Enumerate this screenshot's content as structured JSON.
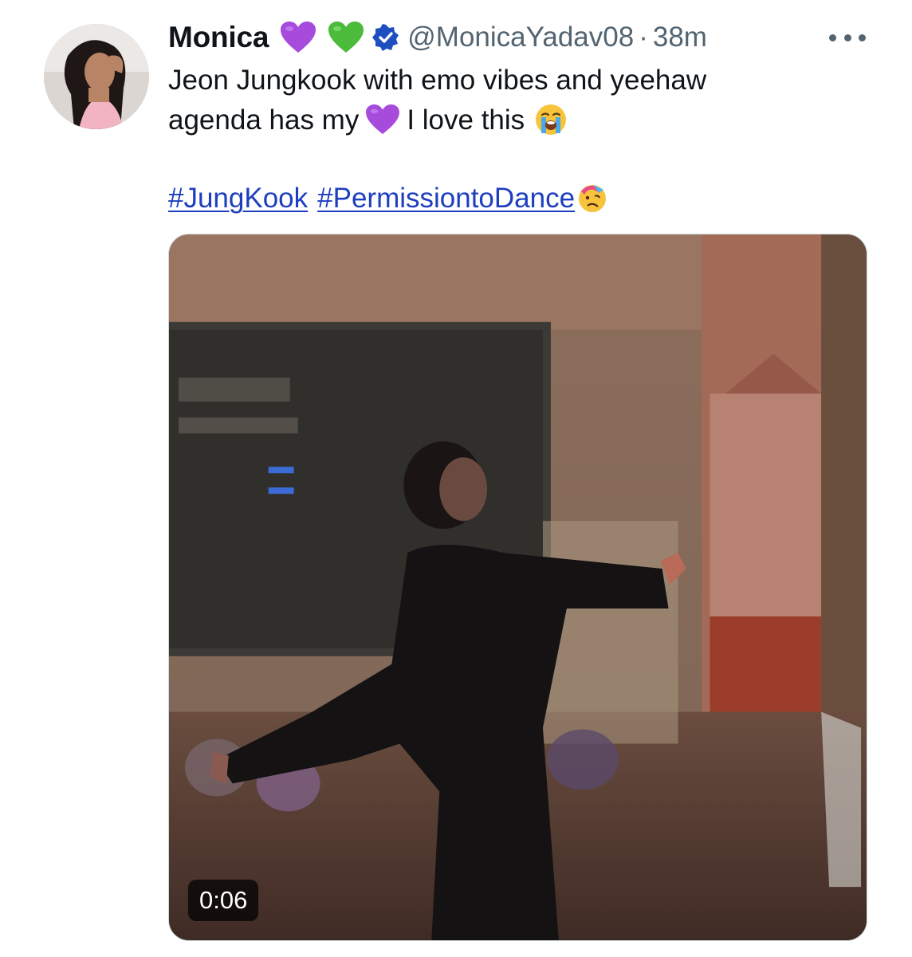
{
  "tweet": {
    "display_name": "Monica",
    "handle": "@MonicaYadav08",
    "separator": "·",
    "timestamp": "38m",
    "name_emojis": [
      "purple-heart-icon",
      "green-heart-icon"
    ],
    "verified": true,
    "text_line1": "Jeon Jungkook with emo vibes and yeehaw",
    "text_line2_a": "agenda has my",
    "text_line2_b": "I love this",
    "hashtags": [
      "#JungKook",
      "#PermissiontoDance"
    ],
    "media": {
      "type": "video",
      "duration": "0:06"
    }
  },
  "colors": {
    "link": "#1d3fbf",
    "secondary_text": "#536471",
    "verified_badge": "#1d9bf0",
    "purple_heart": "#a64bdc",
    "green_heart": "#4cbb3b"
  }
}
